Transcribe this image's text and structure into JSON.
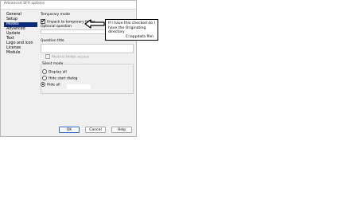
{
  "window": {
    "title": "Advanced SFX options"
  },
  "sidebar": {
    "items": [
      {
        "label": "General"
      },
      {
        "label": "Setup"
      },
      {
        "label": "Modes"
      },
      {
        "label": "Advanced"
      },
      {
        "label": "Update"
      },
      {
        "label": "Text"
      },
      {
        "label": "Logo and icon"
      },
      {
        "label": "License"
      },
      {
        "label": "Module"
      }
    ],
    "selected": "Modes"
  },
  "modes": {
    "temporary_mode_label": "Temporary mode",
    "unpack_temp_label": "Unpack to temporary folder",
    "unpack_temp_checked": true,
    "optional_question_label": "Optional question",
    "optional_question_value": "",
    "question_title_label": "Question title",
    "question_title_value": "",
    "restrict_folder_label": "Restrict folder access",
    "restrict_folder_checked": false,
    "silent_mode_label": "Silent mode",
    "silent_options": [
      {
        "label": "Display all",
        "selected": false
      },
      {
        "label": "Hide start dialog",
        "selected": false
      },
      {
        "label": "Hide all",
        "selected": true
      }
    ]
  },
  "buttons": {
    "ok": "OK",
    "cancel": "Cancel",
    "help": "Help"
  },
  "annotation": {
    "line1": "If I have this checked do I",
    "line2": "have the Originating",
    "line3": "directory",
    "path": "C:\\appdata file\\"
  }
}
